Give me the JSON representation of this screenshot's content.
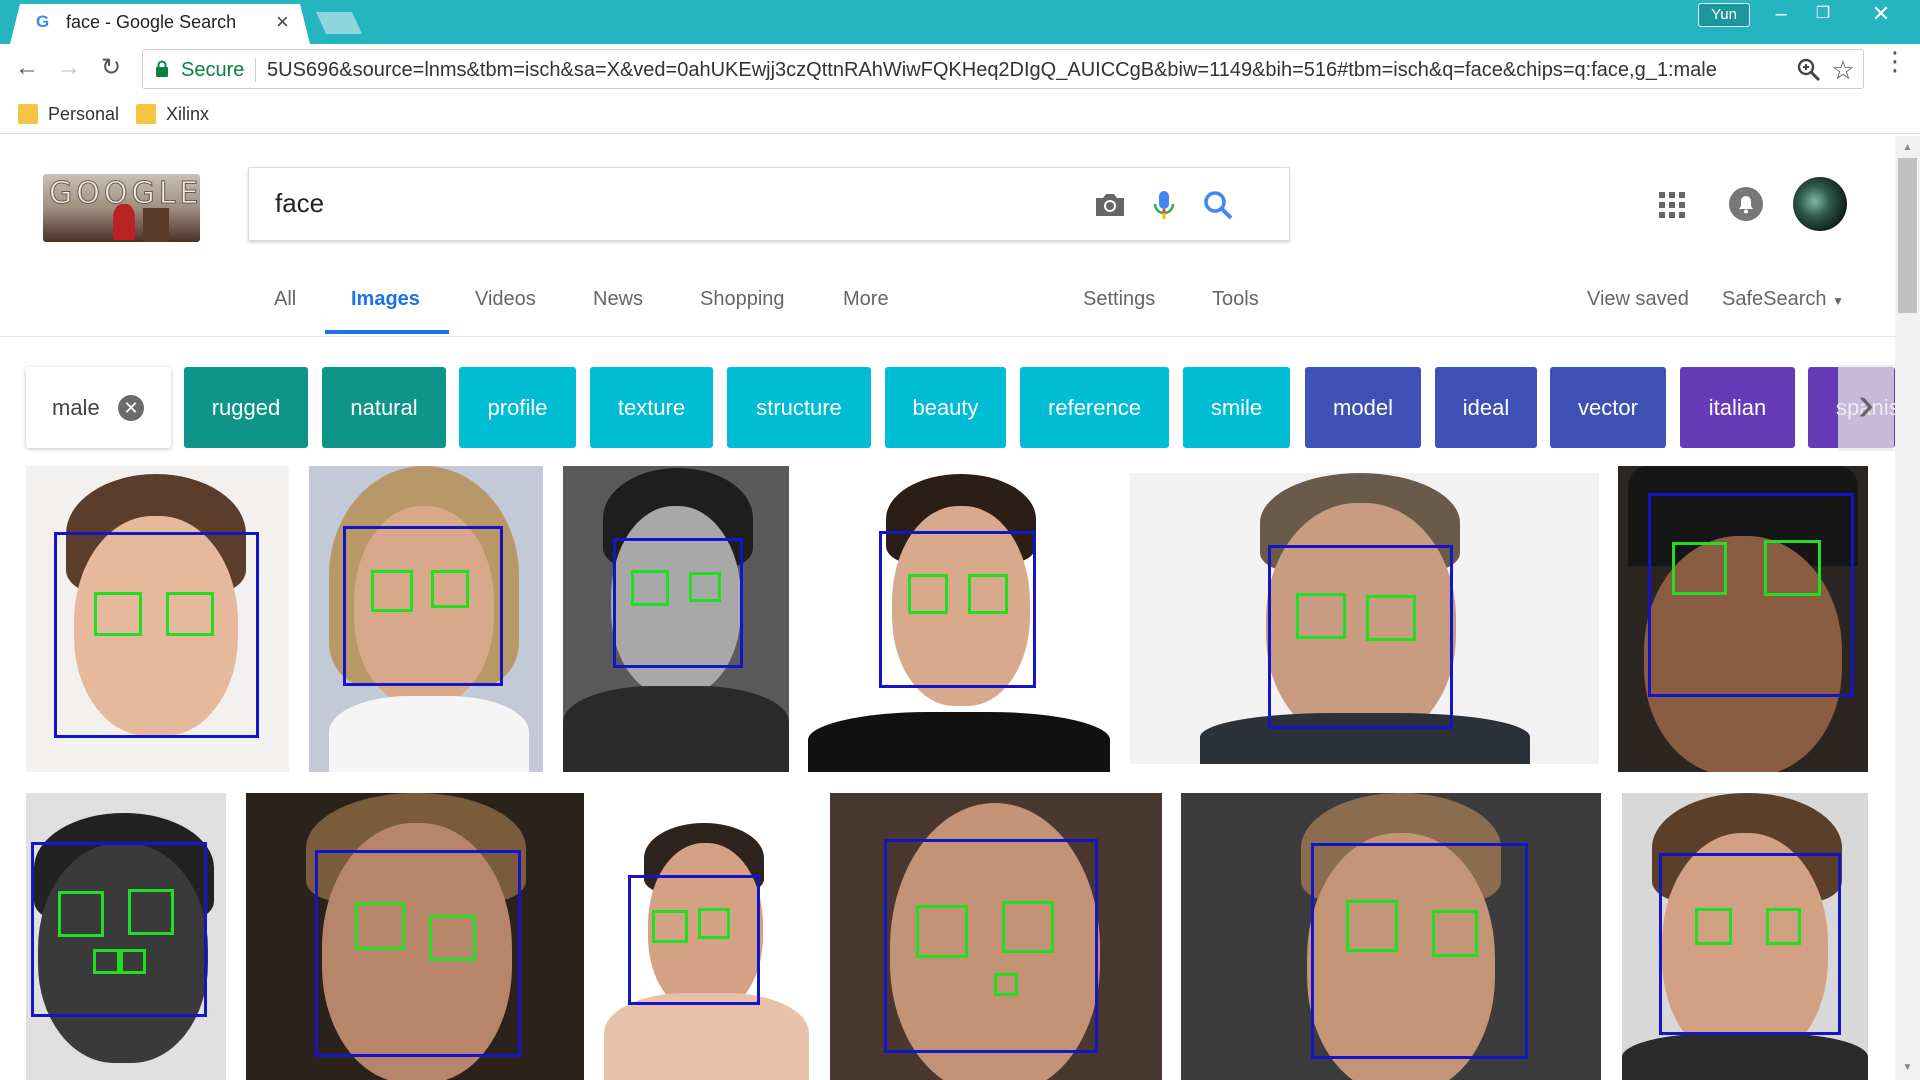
{
  "browser": {
    "tab_title": "face - Google Search",
    "tab_favicon": "G",
    "user_badge": "Yun",
    "secure_label": "Secure",
    "url": "5US696&source=lnms&tbm=isch&sa=X&ved=0ahUKEwjj3czQttnRAhWiwFQKHeq2DIgQ_AUICCgB&biw=1149&bih=516#tbm=isch&q=face&chips=q:face,g_1:male",
    "bookmarks": [
      "Personal",
      "Xilinx"
    ],
    "icons": [
      "back-icon",
      "forward-icon",
      "reload-icon",
      "lock-icon",
      "zoom-icon",
      "star-icon",
      "menu-icon"
    ]
  },
  "header": {
    "logo_text": "GOOGLE",
    "query": "face",
    "icons": [
      "camera-icon",
      "mic-icon",
      "search-icon",
      "apps-icon",
      "notifications-icon",
      "avatar"
    ]
  },
  "tabs": {
    "items": [
      "All",
      "Images",
      "Videos",
      "News",
      "Shopping",
      "More"
    ],
    "settings": "Settings",
    "tools": "Tools",
    "view_saved": "View saved",
    "safesearch": "SafeSearch"
  },
  "chips": {
    "selected": "male",
    "items": [
      "rugged",
      "natural",
      "profile",
      "texture",
      "structure",
      "beauty",
      "reference",
      "smile",
      "model",
      "ideal",
      "vector",
      "italian",
      "spanish"
    ],
    "colors": {
      "rugged": "#0e9488",
      "natural": "#0e9488",
      "profile": "#00bcd4",
      "texture": "#00bcd4",
      "structure": "#00bcd4",
      "beauty": "#00bcd4",
      "reference": "#00bcd4",
      "smile": "#00bcd4",
      "model": "#3f51b5",
      "ideal": "#3f51b5",
      "vector": "#3f51b5",
      "italian": "#673ab7",
      "spanish": "#673ab7"
    }
  },
  "annotations": {
    "face_box_color": "#1515c8",
    "eye_box_color": "#22dd22"
  }
}
